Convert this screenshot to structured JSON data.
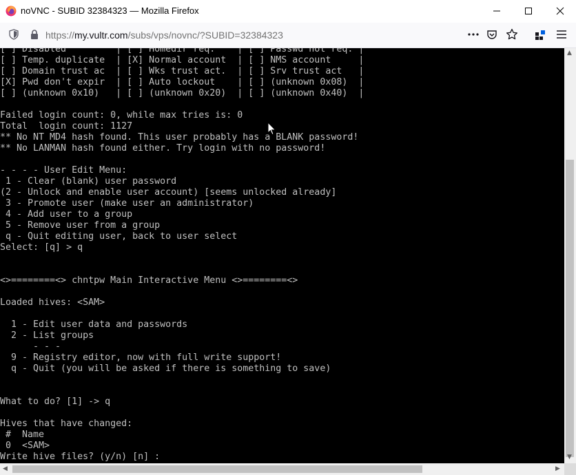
{
  "window": {
    "title": "noVNC - SUBID 32384323 — Mozilla Firefox",
    "favicon": "firefox-icon",
    "controls": [
      "minimize-icon",
      "maximize-icon",
      "close-icon"
    ]
  },
  "navbar": {
    "url_prefix": "https://",
    "url_host": "my.vultr.com",
    "url_path": "/subs/vps/novnc/?SUBID=32384323",
    "icons": [
      "shield-icon",
      "lock-icon",
      "more-icon",
      "pocket-icon",
      "bookmark-star-icon",
      "extensions-icon",
      "hamburger-menu-icon"
    ]
  },
  "terminal": {
    "lines": [
      "[ ] Disabled         | [ ] Homedir req.    | [ ] Passwd not req. |",
      "[ ] Temp. duplicate  | [X] Normal account  | [ ] NMS account     |",
      "[ ] Domain trust ac  | [ ] Wks trust act.  | [ ] Srv trust act   |",
      "[X] Pwd don't expir  | [ ] Auto lockout    | [ ] (unknown 0x08)  |",
      "[ ] (unknown 0x10)   | [ ] (unknown 0x20)  | [ ] (unknown 0x40)  |",
      "",
      "Failed login count: 0, while max tries is: 0",
      "Total  login count: 1127",
      "** No NT MD4 hash found. This user probably has a BLANK password!",
      "** No LANMAN hash found either. Try login with no password!",
      "",
      "- - - - User Edit Menu:",
      " 1 - Clear (blank) user password",
      "(2 - Unlock and enable user account) [seems unlocked already]",
      " 3 - Promote user (make user an administrator)",
      " 4 - Add user to a group",
      " 5 - Remove user from a group",
      " q - Quit editing user, back to user select",
      "Select: [q] > q",
      "",
      "",
      "<>========<> chntpw Main Interactive Menu <>========<>",
      "",
      "Loaded hives: <SAM>",
      "",
      "  1 - Edit user data and passwords",
      "  2 - List groups",
      "      - - -",
      "  9 - Registry editor, now with full write support!",
      "  q - Quit (you will be asked if there is something to save)",
      "",
      "",
      "What to do? [1] -> q",
      "",
      "Hives that have changed:",
      " #  Name",
      " 0  <SAM>",
      "Write hive files? (y/n) [n] :"
    ]
  },
  "colors": {
    "terminal_bg": "#000000",
    "terminal_fg": "#c0c0c0",
    "chrome_bg": "#f9f9fb"
  }
}
